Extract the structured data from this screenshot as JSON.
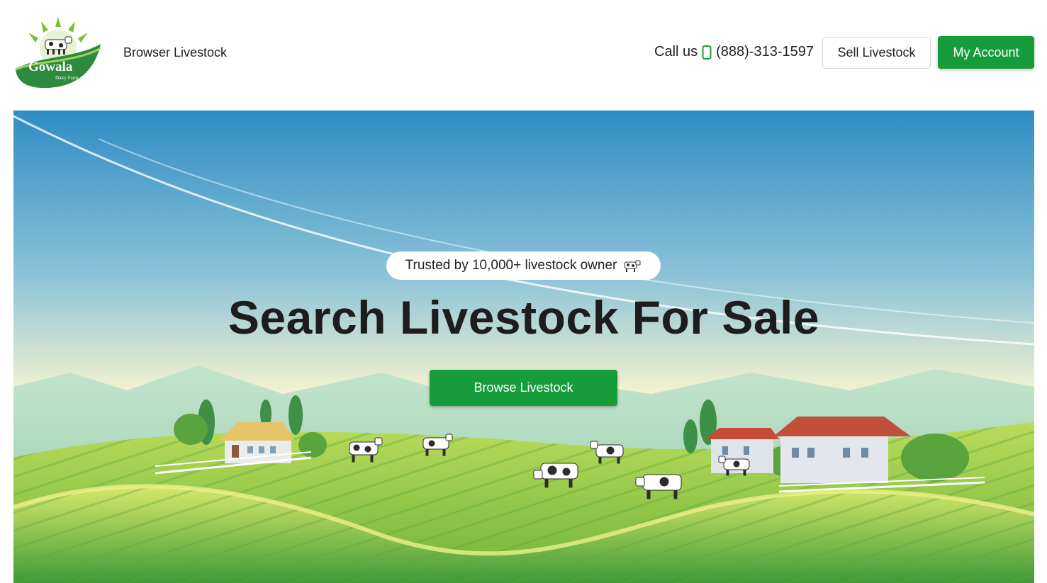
{
  "brand": {
    "name": "Gowala",
    "tagline": "Dairy Farm"
  },
  "nav": {
    "browse_link": "Browser Livestock"
  },
  "header": {
    "call_label": "Call us",
    "phone": "(888)-313-1597",
    "sell_button": "Sell Livestock",
    "account_button": "My Account"
  },
  "hero": {
    "badge_text": "Trusted by 10,000+ livestock owner",
    "headline": "Search Livestock For Sale",
    "cta_button": "Browse Livestock"
  },
  "colors": {
    "accent": "#169c3a",
    "sky_top": "#2f8cc4",
    "field": "#7fbf3a"
  },
  "icons": {
    "phone": "phone-icon",
    "cow": "cow-icon"
  }
}
